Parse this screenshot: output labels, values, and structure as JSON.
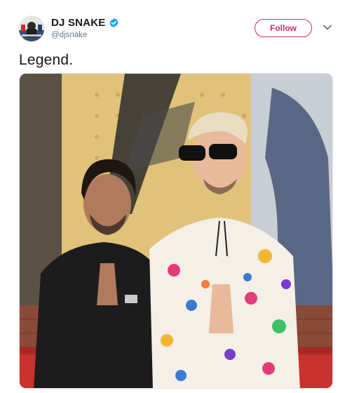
{
  "tweet": {
    "author_name": "DJ SNAKE",
    "author_handle": "@djsnake",
    "follow_label": "Follow",
    "text": "Legend."
  },
  "icons": {
    "verified": "verified-badge-icon",
    "more": "chevron-down-icon"
  },
  "colors": {
    "accent": "#e0245e",
    "verified": "#1da1f2",
    "text": "#14171a",
    "secondary_text": "#657786"
  }
}
